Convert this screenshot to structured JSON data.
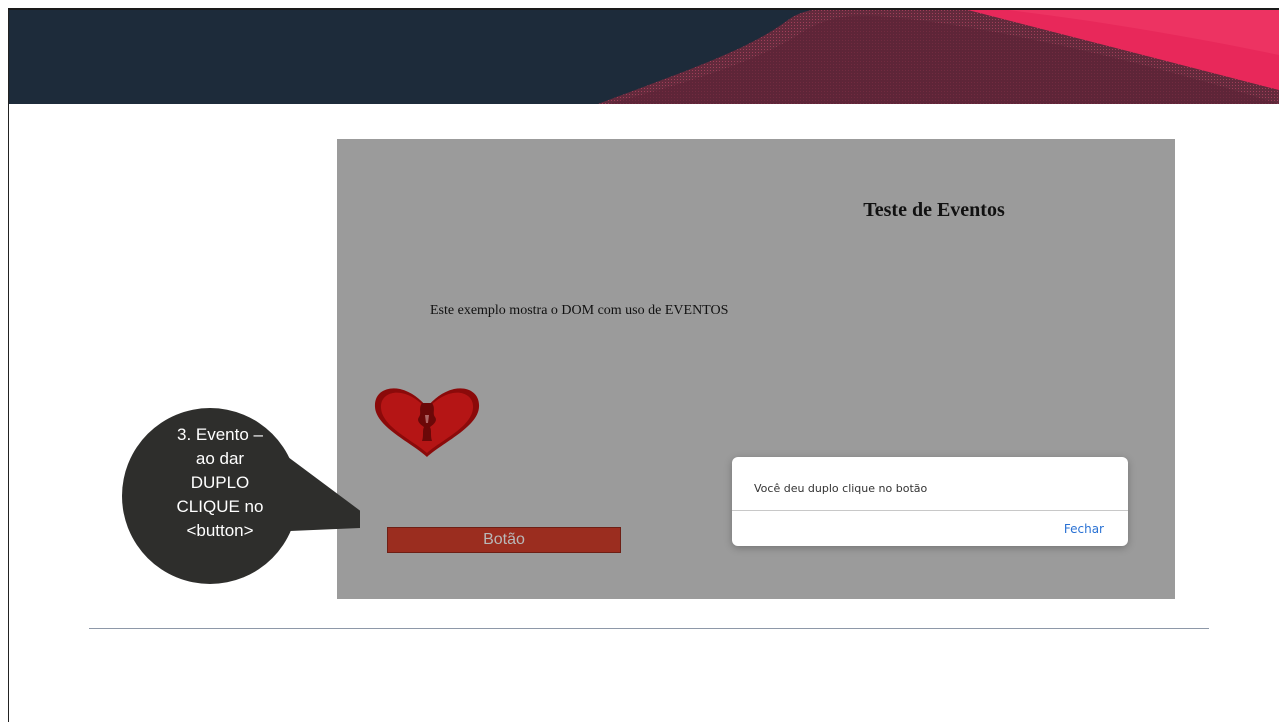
{
  "page": {
    "heading": "Teste de Eventos",
    "paragraph": "Este exemplo mostra o DOM com uso de EVENTOS",
    "button_label": "Botão"
  },
  "dialog": {
    "message": "Você deu duplo clique no botão",
    "close_label": "Fechar"
  },
  "callout": {
    "lines": [
      "3. Evento –",
      "ao dar",
      "DUPLO",
      "CLIQUE no",
      "<button>"
    ]
  },
  "colors": {
    "header_band": "#1d2b3a",
    "accent": "#e8285a",
    "screenshot_bg": "#9b9b9b",
    "button_bg": "#9b2d1f",
    "callout_bg": "#2e2e2c",
    "link": "#2a72d4",
    "heart": "#8b0a0a"
  }
}
